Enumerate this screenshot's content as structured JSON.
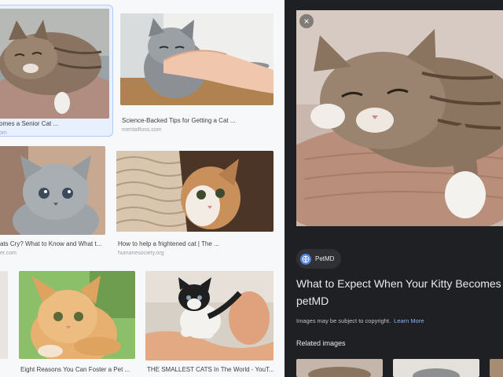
{
  "results": [
    {
      "title": "omes a Senior Cat ...",
      "source": "om",
      "selected": true
    },
    {
      "title": "Science-Backed Tips for Getting a Cat ...",
      "source": "mentalfloss.com"
    },
    {
      "title": "ats Cry? What to Know and What t...",
      "source": "er.com"
    },
    {
      "title": "How to help a frightened cat | The ...",
      "source": "humanesociety.org"
    },
    {
      "title": "Eight Reasons You Can Foster a Pet ...",
      "source": ""
    },
    {
      "title": "THE SMALLEST CATS In The World - YouT...",
      "source": ""
    }
  ],
  "preview": {
    "close_icon": "×",
    "site_name": "PetMD",
    "title_line1": "What to Expect When Your Kitty Becomes a S",
    "title_line2": "petMD",
    "copyright": "Images may be subject to copyright.",
    "learn_more": "Learn More",
    "related_heading": "Related images"
  },
  "colors": {
    "panel_bg": "#1f2023",
    "link": "#8ab4f8",
    "selected_bg": "#e8f0fe"
  }
}
